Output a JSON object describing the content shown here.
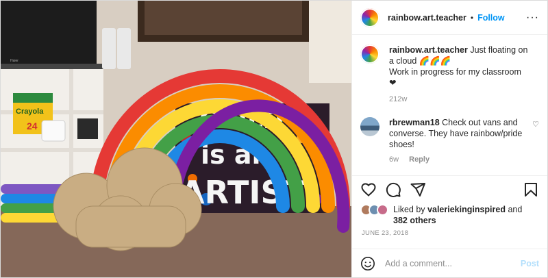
{
  "photo": {
    "tv_brand": "Haier",
    "crayon_box_brand": "Crayola",
    "crayon_box_count": "24",
    "sign_text": [
      "CHILD",
      "is an",
      "ARTIST"
    ]
  },
  "header": {
    "username": "rainbow.art.teacher",
    "separator": "•",
    "follow_label": "Follow",
    "more_label": "···"
  },
  "caption": {
    "username": "rainbow.art.teacher",
    "text": "Just floating on a cloud 🌈🌈🌈",
    "text2": "Work in progress for my classroom",
    "text3": "❤",
    "time": "212w"
  },
  "comment": {
    "username": "rbrewman18",
    "text": "Check out vans and converse. They have rainbow/pride shoes!",
    "time": "6w",
    "reply_label": "Reply",
    "like_icon": "♡"
  },
  "likes": {
    "prefix": "Liked by",
    "user": "valeriekinginspired",
    "and": "and",
    "others": "382 others"
  },
  "date": "JUNE 23, 2018",
  "add_comment": {
    "placeholder": "Add a comment...",
    "post_label": "Post"
  }
}
